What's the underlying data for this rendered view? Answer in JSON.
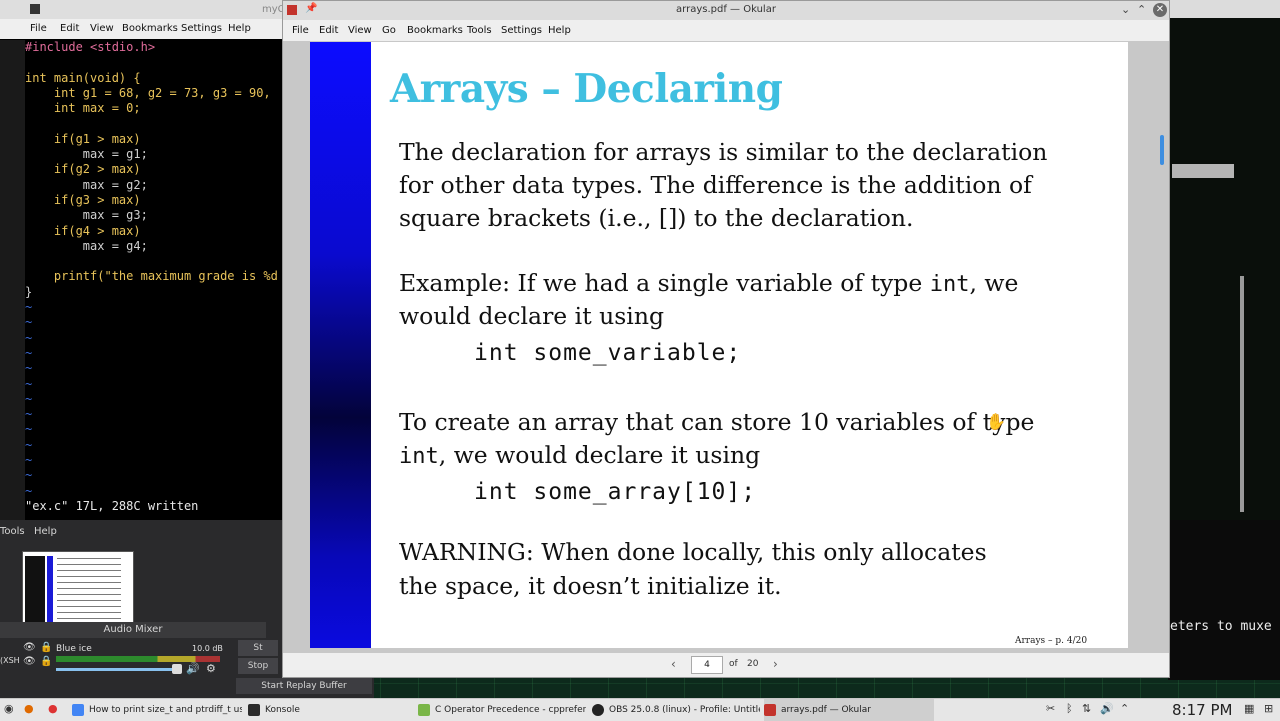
{
  "vim": {
    "window_title": "myC",
    "menu": [
      "File",
      "Edit",
      "View",
      "Bookmarks",
      "Settings",
      "Help"
    ],
    "lines": [
      "#include <stdio.h>",
      "",
      "int main(void) {",
      "    int g1 = 68, g2 = 73, g3 = 90,",
      "    int max = 0;",
      "",
      "    if(g1 > max)",
      "        max = g1;",
      "    if(g2 > max)",
      "        max = g2;",
      "    if(g3 > max)",
      "        max = g3;",
      "    if(g4 > max)",
      "        max = g4;",
      "",
      "    printf(\"the maximum grade is %d",
      "}"
    ],
    "tilde": "~",
    "status": "\"ex.c\" 17L, 288C written"
  },
  "obs": {
    "menu": [
      "Tools",
      "Help"
    ],
    "audio_mixer_label": "Audio Mixer",
    "track_name": "Blue ice",
    "track_db": "10.0 dB",
    "left_label": "(XSH",
    "start_replay_buffer": "Start Replay Buffer",
    "stop_label": "Stop",
    "st_label": "St"
  },
  "okular": {
    "window_title": "arrays.pdf — Okular",
    "menu": [
      "File",
      "Edit",
      "View",
      "Go",
      "Bookmarks",
      "Tools",
      "Settings",
      "Help"
    ],
    "page_current": "4",
    "page_of": "of",
    "page_total": "20"
  },
  "slide": {
    "title": "Arrays – Declaring",
    "para1": [
      "The declaration for arrays is similar to the declaration",
      "for other data types. The difference is the addition of",
      "square brackets (i.e., []) to the declaration."
    ],
    "ex1_a": "Example: If we had a single variable of type ",
    "ex1_mono": "int",
    "ex1_b": ", we",
    "ex1_line2": "would declare it using",
    "code1": "int some_variable;",
    "ex2_line1": "To create an array that can store 10 variables of type",
    "ex2_mono": "int",
    "ex2_line2": ", we would declare it using",
    "code2": "int some_array[10];",
    "warn1": "WARNING: When done locally, this only allocates",
    "warn2": "the space, it doesn’t initialize it.",
    "footer": "Arrays – p. 4/20"
  },
  "right_terminal": {
    "text": "eters to muxe"
  },
  "taskbar": {
    "items": [
      {
        "label": "How to print size_t and ptrdiff_t us...",
        "color": "#4285f4"
      },
      {
        "label": "Konsole",
        "color": "#2b2b2b"
      },
      {
        "label": "C Operator Precedence - cpprefer...",
        "color": "#7ab648"
      },
      {
        "label": "OBS 25.0.8 (linux) - Profile: Untitle...",
        "color": "#222222"
      },
      {
        "label": "arrays.pdf — Okular",
        "color": "#c3332c"
      }
    ],
    "clock": "8:17 PM"
  }
}
